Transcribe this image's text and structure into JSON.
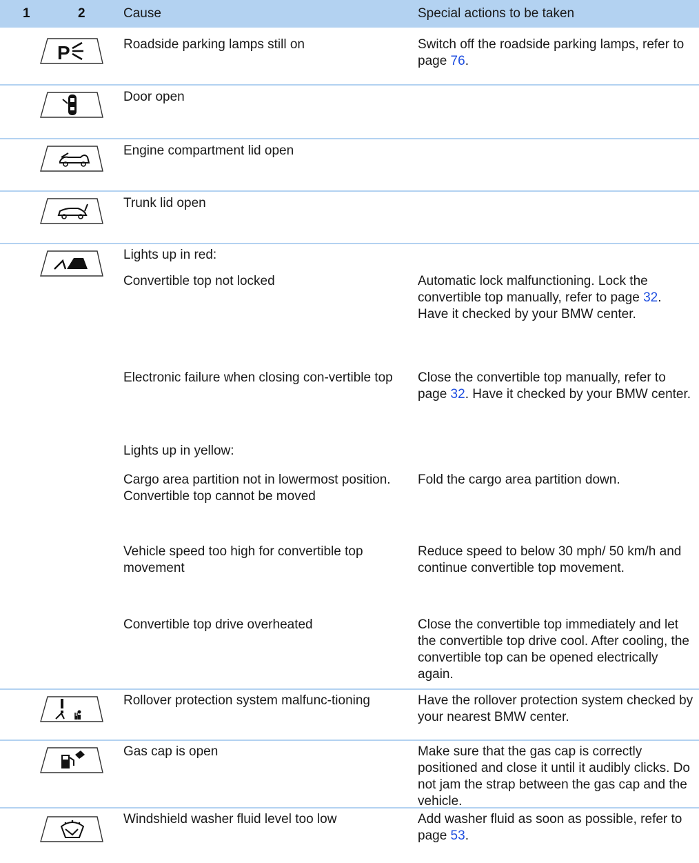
{
  "header": {
    "col1": "1",
    "col2": "2",
    "cause": "Cause",
    "actions": "Special actions to be taken"
  },
  "rows": {
    "parking": {
      "icon": "roadside-parking-lamp-icon",
      "cause": "Roadside parking lamps still on",
      "action_pre": "Switch off the roadside parking lamps, refer to page ",
      "action_page": "76",
      "action_post": "."
    },
    "door": {
      "icon": "door-open-icon",
      "cause": "Door open"
    },
    "engine": {
      "icon": "engine-lid-open-icon",
      "cause": "Engine compartment lid open"
    },
    "trunk": {
      "icon": "trunk-lid-open-icon",
      "cause": "Trunk lid open"
    },
    "convertible": {
      "icon": "convertible-top-icon",
      "red_heading": "Lights up in red:",
      "r1_cause": "Convertible top not locked",
      "r1_action_pre": "Automatic lock malfunctioning. Lock the convertible top manually, refer to page ",
      "r1_action_page": "32",
      "r1_action_post": ". Have it checked by your BMW center.",
      "r2_cause": "Electronic failure when closing con-vertible top",
      "r2_action_pre": "Close the convertible top manually, refer to page ",
      "r2_action_page": "32",
      "r2_action_post": ". Have it checked by your BMW center.",
      "yellow_heading": "Lights up in yellow:",
      "y1_cause": "Cargo area partition not in lowermost position. Convertible top cannot be moved",
      "y1_action": "Fold the cargo area partition down.",
      "y2_cause": "Vehicle speed too high for convertible top movement",
      "y2_action": "Reduce speed to below 30 mph/ 50 km/h and continue convertible top movement.",
      "y3_cause": "Convertible top drive overheated",
      "y3_action": "Close the convertible top immediately and let the convertible top drive cool. After cooling, the convertible top can be opened electrically again."
    },
    "rollover": {
      "icon": "rollover-protection-icon",
      "cause": "Rollover protection system malfunc-tioning",
      "action": "Have the rollover protection system checked by your nearest BMW center."
    },
    "gascap": {
      "icon": "gas-cap-icon",
      "cause": "Gas cap is open",
      "action": "Make sure that the gas cap is correctly positioned and close it until it audibly clicks. Do not jam the strap between the gas cap and the vehicle."
    },
    "washer": {
      "icon": "washer-fluid-icon",
      "cause": "Windshield washer fluid level too low",
      "action_pre": "Add washer fluid as soon as possible, refer to page ",
      "action_page": "53",
      "action_post": "."
    }
  },
  "colors": {
    "header_bg": "#b3d2f1",
    "rule": "#b3d2f1",
    "link": "#1f4fe0",
    "text": "#1a1a1a"
  }
}
